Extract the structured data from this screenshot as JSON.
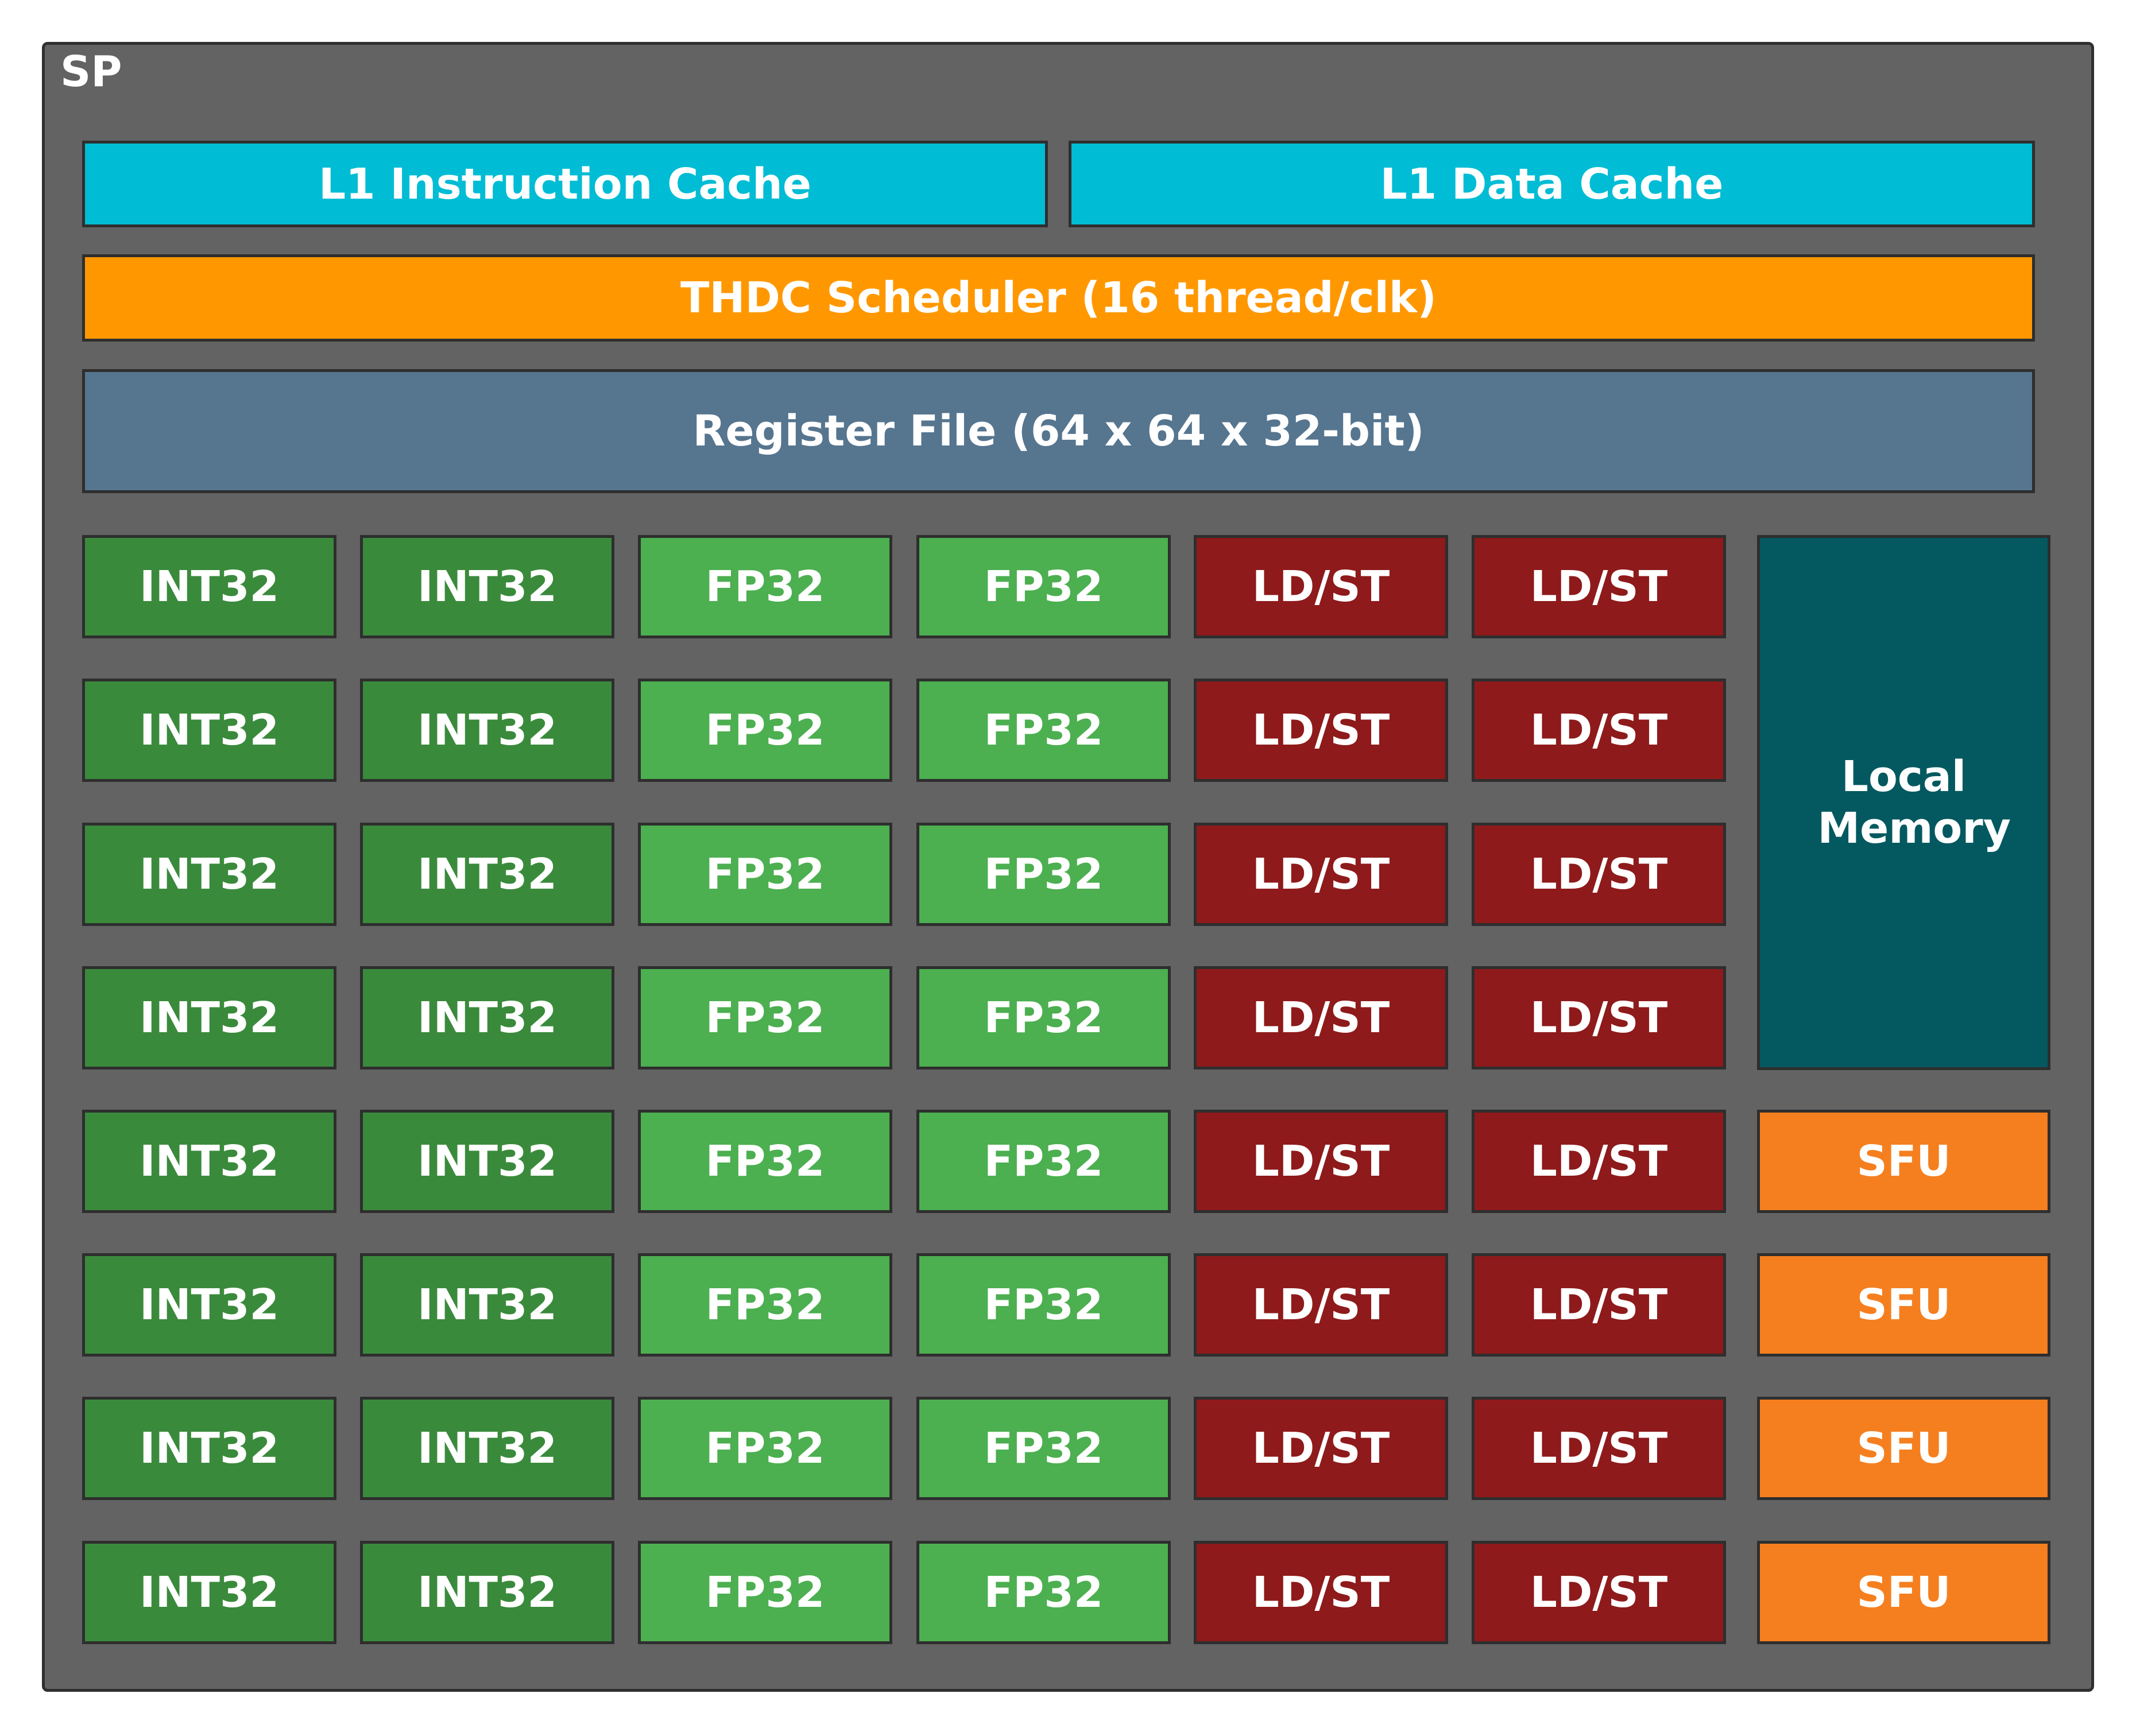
{
  "sp": {
    "label": "SP",
    "l1_instruction_cache": "L1 Instruction Cache",
    "l1_data_cache": "L1 Data Cache",
    "scheduler": "THDC Scheduler (16 thread/clk)",
    "register_file": "Register File (64 x 64 x 32-bit)",
    "local_memory": "Local Memory",
    "unit_grid": {
      "rows": 8,
      "columns": [
        "INT32",
        "INT32",
        "FP32",
        "FP32",
        "LD/ST",
        "LD/ST"
      ]
    },
    "sfu": {
      "label": "SFU",
      "count": 4
    },
    "colors": {
      "frame": "#636363",
      "cache": "#00bcd4",
      "scheduler": "#ff9800",
      "register_file": "#56758f",
      "int32": "#3a8a3c",
      "fp32": "#4caf50",
      "ldst": "#8e1a1b",
      "local_memory": "#045960",
      "sfu": "#f57f1f"
    }
  }
}
